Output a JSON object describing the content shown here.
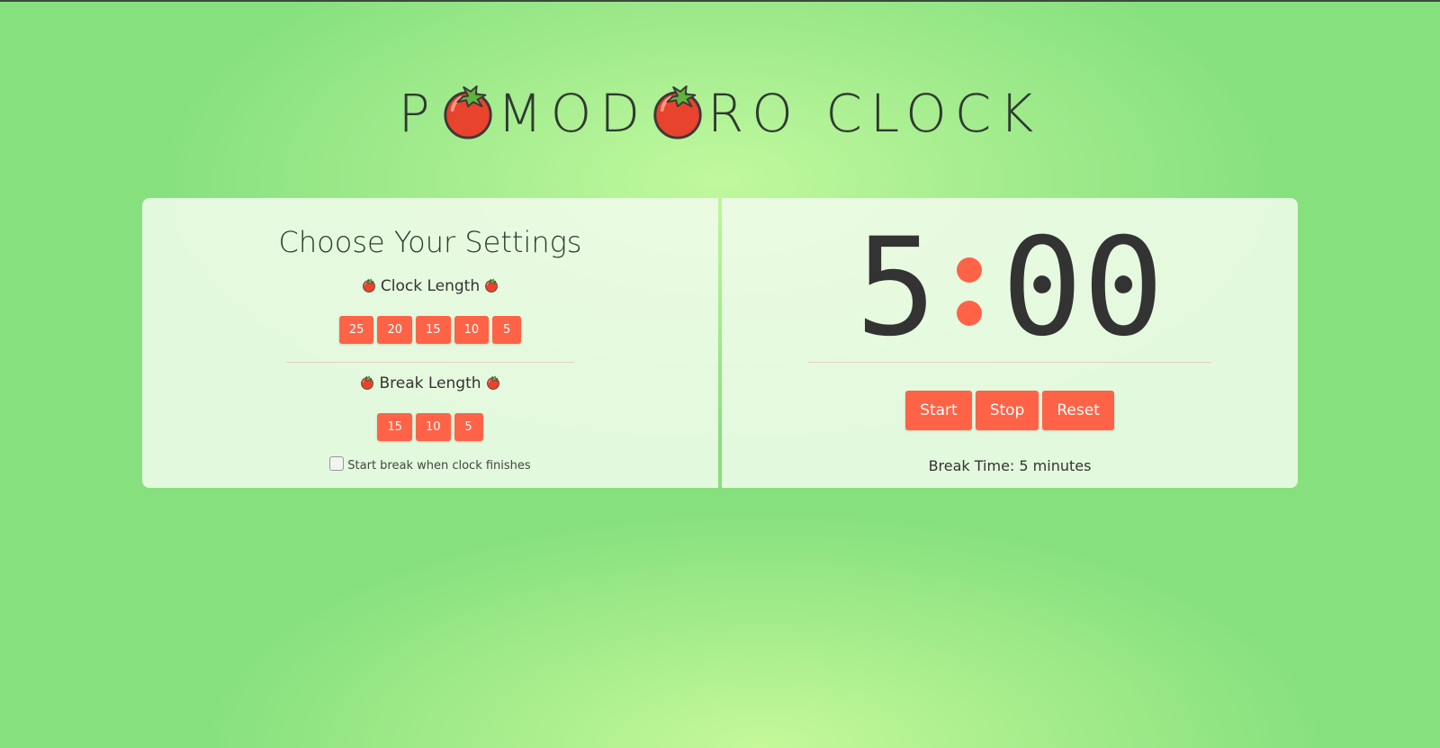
{
  "app": {
    "title_parts": [
      "P",
      "MOD",
      "RO CLOCK"
    ],
    "title_icon": "tomato-icon"
  },
  "settings": {
    "title": "Choose Your Settings",
    "clock_length_label": "Clock Length",
    "clock_options": [
      "25",
      "20",
      "15",
      "10",
      "5"
    ],
    "break_length_label": "Break Length",
    "break_options": [
      "15",
      "10",
      "5"
    ],
    "auto_break_label": "Start break when clock finishes",
    "auto_break_checked": false
  },
  "timer": {
    "minutes": "5",
    "seconds": "00",
    "start_label": "Start",
    "stop_label": "Stop",
    "reset_label": "Reset",
    "status": "Break Time: 5 minutes"
  },
  "colors": {
    "accent": "#ff6347",
    "text": "#333333",
    "background": "#86e07e"
  }
}
